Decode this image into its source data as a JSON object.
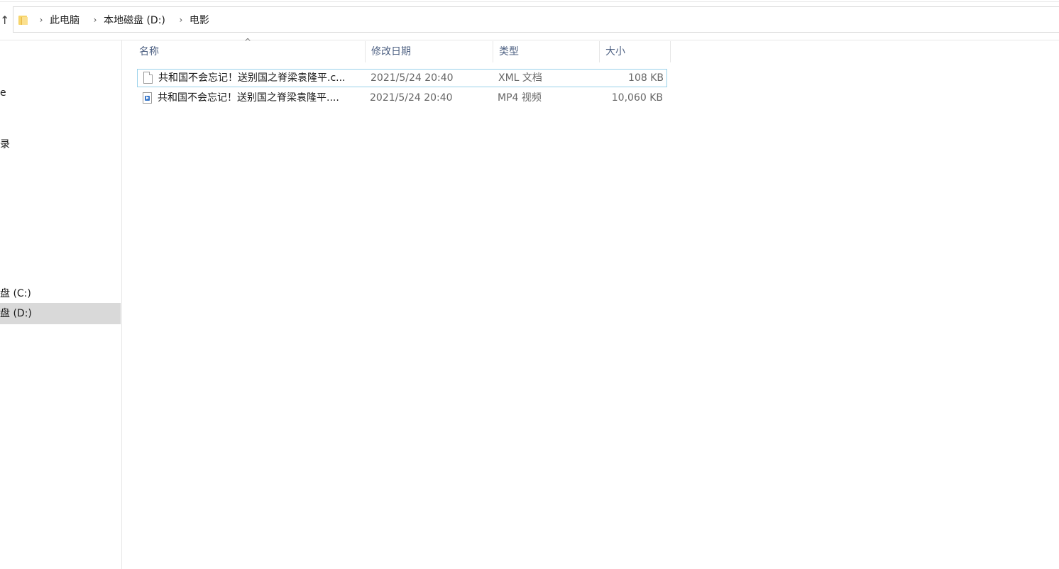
{
  "nav": {
    "up_glyph": "↑",
    "separator": "›"
  },
  "breadcrumb": [
    "此电脑",
    "本地磁盘 (D:)",
    "电影"
  ],
  "sidebar": {
    "items": [
      {
        "label": "e",
        "selected": false
      },
      {
        "label": "录",
        "selected": false
      },
      {
        "label": "盘 (C:)",
        "selected": false
      },
      {
        "label": "盘 (D:)",
        "selected": true
      }
    ]
  },
  "columns": {
    "name": "名称",
    "date": "修改日期",
    "type": "类型",
    "size": "大小",
    "sort_indicator": "^"
  },
  "files": [
    {
      "name": "共和国不会忘记！送别国之脊梁袁隆平.c...",
      "date": "2021/5/24 20:40",
      "type": "XML 文档",
      "size": "108 KB",
      "icon": "document-icon"
    },
    {
      "name": "共和国不会忘记！送别国之脊梁袁隆平....",
      "date": "2021/5/24 20:40",
      "type": "MP4 视频",
      "size": "10,060 KB",
      "icon": "video-file-icon"
    }
  ],
  "colors": {
    "selected_nav": "#d9d9d9",
    "focus_border": "#99d1ea",
    "header_text": "#4d6082"
  }
}
